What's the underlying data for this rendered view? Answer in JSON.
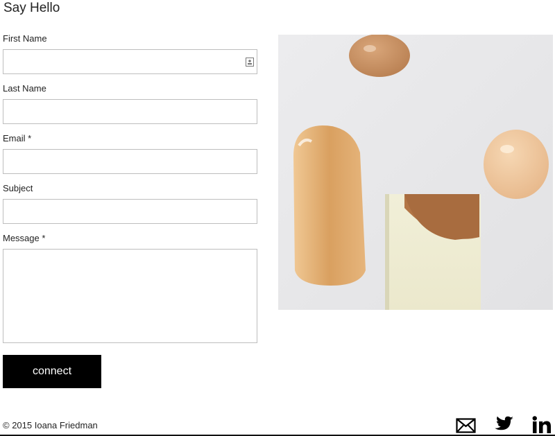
{
  "page": {
    "title": "Say Hello"
  },
  "form": {
    "first_name_label": "First Name",
    "first_name_value": "",
    "last_name_label": "Last Name",
    "last_name_value": "",
    "email_label": "Email *",
    "email_value": "",
    "subject_label": "Subject",
    "subject_value": "",
    "message_label": "Message *",
    "message_value": "",
    "submit_label": "connect"
  },
  "image": {
    "icon": "foundation-swatches-photo"
  },
  "footer": {
    "copyright": "© 2015 Ioana Friedman",
    "social": [
      {
        "icon": "mail-icon"
      },
      {
        "icon": "twitter-icon"
      },
      {
        "icon": "linkedin-icon"
      }
    ]
  },
  "colors": {
    "button_bg": "#000000",
    "input_border": "#bdbdbd",
    "photo_bg": "#e9e9eb"
  }
}
